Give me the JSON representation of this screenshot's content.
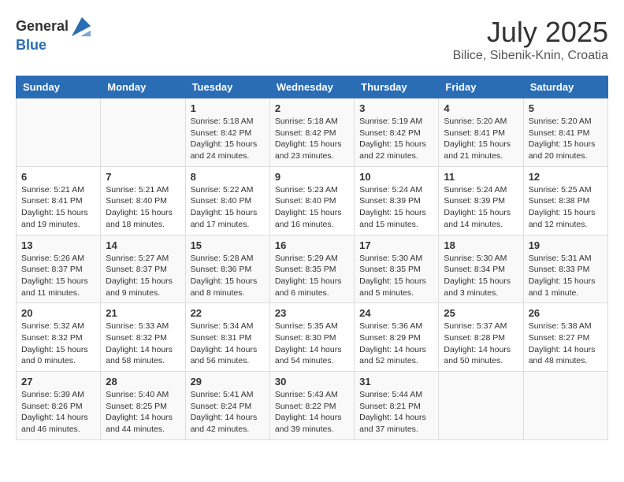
{
  "header": {
    "logo_general": "General",
    "logo_blue": "Blue",
    "month": "July 2025",
    "location": "Bilice, Sibenik-Knin, Croatia"
  },
  "calendar": {
    "days_of_week": [
      "Sunday",
      "Monday",
      "Tuesday",
      "Wednesday",
      "Thursday",
      "Friday",
      "Saturday"
    ],
    "weeks": [
      [
        {
          "day": "",
          "info": ""
        },
        {
          "day": "",
          "info": ""
        },
        {
          "day": "1",
          "info": "Sunrise: 5:18 AM\nSunset: 8:42 PM\nDaylight: 15 hours and 24 minutes."
        },
        {
          "day": "2",
          "info": "Sunrise: 5:18 AM\nSunset: 8:42 PM\nDaylight: 15 hours and 23 minutes."
        },
        {
          "day": "3",
          "info": "Sunrise: 5:19 AM\nSunset: 8:42 PM\nDaylight: 15 hours and 22 minutes."
        },
        {
          "day": "4",
          "info": "Sunrise: 5:20 AM\nSunset: 8:41 PM\nDaylight: 15 hours and 21 minutes."
        },
        {
          "day": "5",
          "info": "Sunrise: 5:20 AM\nSunset: 8:41 PM\nDaylight: 15 hours and 20 minutes."
        }
      ],
      [
        {
          "day": "6",
          "info": "Sunrise: 5:21 AM\nSunset: 8:41 PM\nDaylight: 15 hours and 19 minutes."
        },
        {
          "day": "7",
          "info": "Sunrise: 5:21 AM\nSunset: 8:40 PM\nDaylight: 15 hours and 18 minutes."
        },
        {
          "day": "8",
          "info": "Sunrise: 5:22 AM\nSunset: 8:40 PM\nDaylight: 15 hours and 17 minutes."
        },
        {
          "day": "9",
          "info": "Sunrise: 5:23 AM\nSunset: 8:40 PM\nDaylight: 15 hours and 16 minutes."
        },
        {
          "day": "10",
          "info": "Sunrise: 5:24 AM\nSunset: 8:39 PM\nDaylight: 15 hours and 15 minutes."
        },
        {
          "day": "11",
          "info": "Sunrise: 5:24 AM\nSunset: 8:39 PM\nDaylight: 15 hours and 14 minutes."
        },
        {
          "day": "12",
          "info": "Sunrise: 5:25 AM\nSunset: 8:38 PM\nDaylight: 15 hours and 12 minutes."
        }
      ],
      [
        {
          "day": "13",
          "info": "Sunrise: 5:26 AM\nSunset: 8:37 PM\nDaylight: 15 hours and 11 minutes."
        },
        {
          "day": "14",
          "info": "Sunrise: 5:27 AM\nSunset: 8:37 PM\nDaylight: 15 hours and 9 minutes."
        },
        {
          "day": "15",
          "info": "Sunrise: 5:28 AM\nSunset: 8:36 PM\nDaylight: 15 hours and 8 minutes."
        },
        {
          "day": "16",
          "info": "Sunrise: 5:29 AM\nSunset: 8:35 PM\nDaylight: 15 hours and 6 minutes."
        },
        {
          "day": "17",
          "info": "Sunrise: 5:30 AM\nSunset: 8:35 PM\nDaylight: 15 hours and 5 minutes."
        },
        {
          "day": "18",
          "info": "Sunrise: 5:30 AM\nSunset: 8:34 PM\nDaylight: 15 hours and 3 minutes."
        },
        {
          "day": "19",
          "info": "Sunrise: 5:31 AM\nSunset: 8:33 PM\nDaylight: 15 hours and 1 minute."
        }
      ],
      [
        {
          "day": "20",
          "info": "Sunrise: 5:32 AM\nSunset: 8:32 PM\nDaylight: 15 hours and 0 minutes."
        },
        {
          "day": "21",
          "info": "Sunrise: 5:33 AM\nSunset: 8:32 PM\nDaylight: 14 hours and 58 minutes."
        },
        {
          "day": "22",
          "info": "Sunrise: 5:34 AM\nSunset: 8:31 PM\nDaylight: 14 hours and 56 minutes."
        },
        {
          "day": "23",
          "info": "Sunrise: 5:35 AM\nSunset: 8:30 PM\nDaylight: 14 hours and 54 minutes."
        },
        {
          "day": "24",
          "info": "Sunrise: 5:36 AM\nSunset: 8:29 PM\nDaylight: 14 hours and 52 minutes."
        },
        {
          "day": "25",
          "info": "Sunrise: 5:37 AM\nSunset: 8:28 PM\nDaylight: 14 hours and 50 minutes."
        },
        {
          "day": "26",
          "info": "Sunrise: 5:38 AM\nSunset: 8:27 PM\nDaylight: 14 hours and 48 minutes."
        }
      ],
      [
        {
          "day": "27",
          "info": "Sunrise: 5:39 AM\nSunset: 8:26 PM\nDaylight: 14 hours and 46 minutes."
        },
        {
          "day": "28",
          "info": "Sunrise: 5:40 AM\nSunset: 8:25 PM\nDaylight: 14 hours and 44 minutes."
        },
        {
          "day": "29",
          "info": "Sunrise: 5:41 AM\nSunset: 8:24 PM\nDaylight: 14 hours and 42 minutes."
        },
        {
          "day": "30",
          "info": "Sunrise: 5:43 AM\nSunset: 8:22 PM\nDaylight: 14 hours and 39 minutes."
        },
        {
          "day": "31",
          "info": "Sunrise: 5:44 AM\nSunset: 8:21 PM\nDaylight: 14 hours and 37 minutes."
        },
        {
          "day": "",
          "info": ""
        },
        {
          "day": "",
          "info": ""
        }
      ]
    ]
  }
}
